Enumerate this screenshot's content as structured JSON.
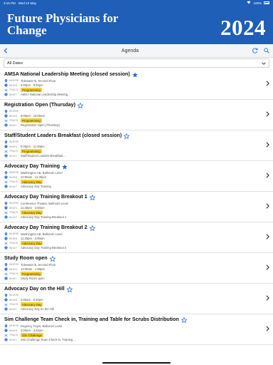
{
  "status": {
    "time": "3:16 PM",
    "date": "Wed 22 May",
    "battery": "100%"
  },
  "banner": {
    "title": "Future Physicians for Change",
    "year": "2024"
  },
  "nav": {
    "title": "Agenda"
  },
  "filter": {
    "value": "All Dates"
  },
  "labels": {
    "where": "WHERE",
    "when": "WHEN",
    "track": "TRACK",
    "what": "WHAT"
  },
  "sessions": [
    {
      "title": "AMSA National Leadership Meeting (closed session)",
      "starred": true,
      "where": "Tidewater B, Second Floor",
      "when": "9:00pm - 9:30pm",
      "track": "Programming",
      "what": "AMSA National Leadership Meeting..."
    },
    {
      "title": "Registration Open (Thursday)",
      "starred": false,
      "where": "",
      "when": "9:00pm - 10:00am",
      "track": "Programming",
      "what": "Registration Open (Thursday)"
    },
    {
      "title": "Staff/Student Leaders Breakfast (closed session)",
      "starred": false,
      "where": "",
      "when": "9:00pm - 11:00pm",
      "track": "Programming",
      "what": "Staff/Student Leaders Breakfast..."
    },
    {
      "title": "Advocacy Day Training",
      "starred": true,
      "where": "Washington AB, Ballroom Level",
      "when": "10:00am - 11:30pm",
      "track": "Advocacy Day",
      "what": "Advocacy Day Training"
    },
    {
      "title": "Advocacy Day Training Breakout 1",
      "starred": false,
      "where": "Conference Theater, Ballroom Level",
      "when": "11:30pm - 2:00am",
      "track": "Advocacy Day",
      "what": "Advocacy Day Training Breakout 1"
    },
    {
      "title": "Advocacy Day Training Breakout 2",
      "starred": false,
      "where": "Washington AB, Ballroom Level",
      "when": "11:30pm - 2:00am",
      "track": "Advocacy Day",
      "what": "Advocacy Day Training Breakout 2"
    },
    {
      "title": "Study Room open",
      "starred": false,
      "where": "Tidewater B, Second Floor",
      "when": "12:00am - 1:59pm",
      "track": "Programming",
      "what": "Study Room open"
    },
    {
      "title": "Advocacy Day on the Hill",
      "starred": false,
      "where": "",
      "when": "2:00am - 6:30pm",
      "track": "Advocacy Day",
      "what": "Advocacy Day on the Hill"
    },
    {
      "title": "Sim Challenge Team Check in, Training and Table for Scrubs Distribution",
      "starred": false,
      "where": "Regency Foyer, Ballroom Level",
      "when": "3:00am - 3:45am",
      "track": "Sim Challenge",
      "what": "Sim Challenge Team Check in, Training..."
    }
  ],
  "colors": {
    "brand": "#1f5fb8",
    "accent": "#2a6ad4",
    "badge": "#f8d32a"
  },
  "icons": {
    "back": "chevron-left-icon",
    "refresh": "refresh-icon",
    "search": "search-icon",
    "filter_caret": "chevron-down-icon",
    "row_chevron": "chevron-right-icon",
    "star": "star-icon",
    "where": "map-pin-icon",
    "when": "clock-icon",
    "track": "shuffle-icon",
    "what": "info-icon"
  }
}
